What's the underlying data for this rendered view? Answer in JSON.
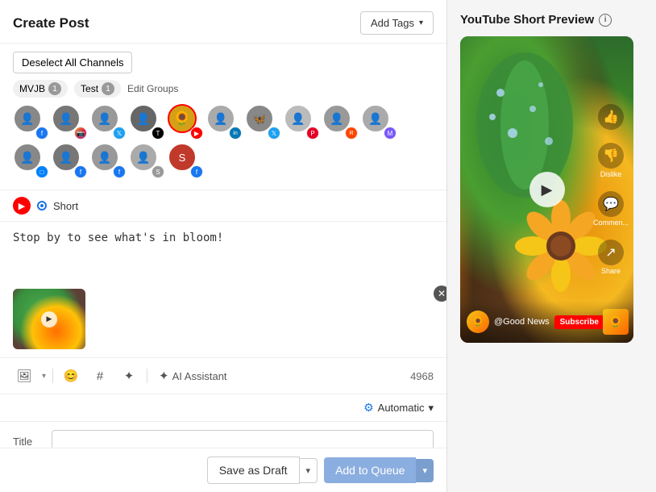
{
  "header": {
    "title": "Create Post",
    "add_tags_label": "Add Tags"
  },
  "channels": {
    "deselect_all_label": "Deselect All Channels",
    "groups": [
      {
        "name": "MVJB",
        "count": "1"
      },
      {
        "name": "Test",
        "count": "1"
      }
    ],
    "edit_groups_label": "Edit Groups"
  },
  "post": {
    "tab_label": "Short",
    "textarea_text": "Stop by to see what's in bloom!",
    "char_count": "4968"
  },
  "toolbar": {
    "emoji_icon": "😊",
    "hashtag_icon": "#",
    "ai_label": "AI Assistant"
  },
  "scheduling": {
    "automatic_label": "Automatic"
  },
  "title_field": {
    "label": "Title",
    "placeholder": ""
  },
  "bottom": {
    "save_draft_label": "Save as Draft",
    "add_queue_label": "Add to Queue"
  },
  "preview": {
    "title": "YouTube Short Preview",
    "channel_name": "@Good News",
    "subscribe_label": "Subscribe"
  }
}
